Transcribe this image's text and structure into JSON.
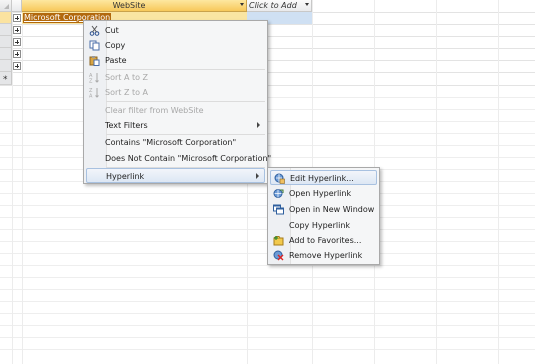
{
  "sheet": {
    "columns": [
      {
        "label": "WebSite",
        "has_dropdown": true,
        "active": true
      },
      {
        "label": "Click to Add",
        "has_dropdown": true,
        "active": false
      }
    ],
    "selected_cell": "Microsoft Corporation",
    "new_row_marker": "*"
  },
  "context_menu": {
    "items": [
      {
        "label": "Cut",
        "icon": "scissors-icon",
        "enabled": true
      },
      {
        "label": "Copy",
        "icon": "copy-icon",
        "enabled": true
      },
      {
        "label": "Paste",
        "icon": "paste-icon",
        "enabled": true
      },
      {
        "label": "Sort A to Z",
        "icon": "sort-ascending-icon",
        "enabled": false
      },
      {
        "label": "Sort Z to A",
        "icon": "sort-descending-icon",
        "enabled": false
      },
      {
        "label": "Clear filter from WebSite",
        "enabled": false
      },
      {
        "label": "Text Filters",
        "enabled": true,
        "submenu": true
      },
      {
        "label": "Contains \"Microsoft Corporation\"",
        "enabled": true
      },
      {
        "label": "Does Not Contain \"Microsoft Corporation\"",
        "enabled": true
      },
      {
        "label": "Hyperlink",
        "enabled": true,
        "submenu": true,
        "highlighted": true
      }
    ]
  },
  "hyperlink_menu": {
    "items": [
      {
        "label": "Edit Hyperlink...",
        "icon": "edit-hyperlink-icon",
        "highlighted": true
      },
      {
        "label": "Open Hyperlink",
        "icon": "open-hyperlink-icon"
      },
      {
        "label": "Open in New Window",
        "icon": "new-window-icon"
      },
      {
        "label": "Copy Hyperlink",
        "icon": "none"
      },
      {
        "label": "Add to Favorites...",
        "icon": "add-favorites-icon"
      },
      {
        "label": "Remove Hyperlink",
        "icon": "remove-hyperlink-icon"
      }
    ]
  },
  "colors": {
    "active_header": "#f7c85a",
    "selected_cell_bg": "#b2690d",
    "menu_highlight": "#dde7f4"
  }
}
